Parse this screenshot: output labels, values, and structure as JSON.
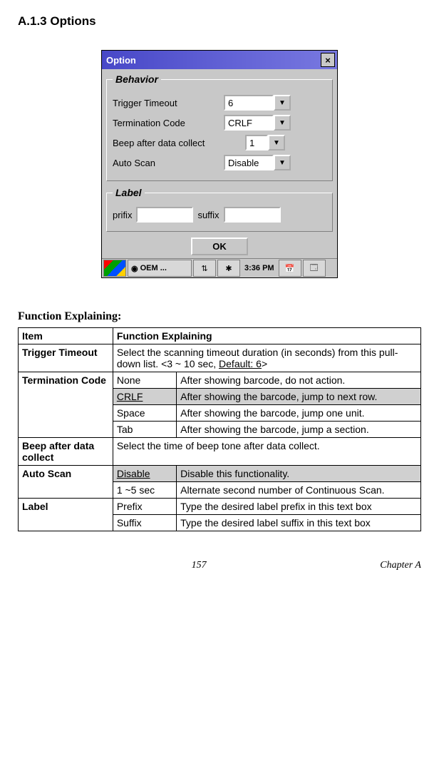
{
  "heading": "A.1.3    Options",
  "window": {
    "title": "Option",
    "behavior_legend": "Behavior",
    "label_legend": "Label",
    "trigger_timeout_label": "Trigger Timeout",
    "trigger_timeout_value": "6",
    "termination_code_label": "Termination Code",
    "termination_code_value": "CRLF",
    "beep_label": "Beep after data collect",
    "beep_value": "1",
    "auto_scan_label": "Auto Scan",
    "auto_scan_value": "Disable",
    "prefix_label": "prifix",
    "suffix_label": "suffix",
    "prefix_value": "",
    "suffix_value": "",
    "ok_label": "OK",
    "taskbar": {
      "oem": "OEM ...",
      "time": "3:36 PM"
    }
  },
  "func_heading": "Function Explaining:",
  "table": {
    "head_item": "Item",
    "head_func": "Function Explaining",
    "rows": {
      "trigger_timeout_item": "Trigger Timeout",
      "trigger_timeout_desc_a": "Select the scanning timeout duration (in seconds) from this pull-down list. <3 ~ 10 sec, ",
      "trigger_timeout_desc_b": "Default: 6",
      "trigger_timeout_desc_c": ">",
      "termination_code_item": "Termination Code",
      "termination_none": "None",
      "termination_none_desc": "After showing barcode, do not action.",
      "termination_crlf": "CRLF",
      "termination_crlf_desc": "After showing the barcode, jump to next row.",
      "termination_space": "Space",
      "termination_space_desc": "After showing the barcode, jump one unit.",
      "termination_tab": "Tab",
      "termination_tab_desc": "After showing the barcode, jump a section.",
      "beep_item": "Beep after data collect",
      "beep_desc": "Select the time of beep tone after data collect.",
      "autoscan_item": "Auto Scan",
      "autoscan_disable": "Disable",
      "autoscan_disable_desc": "Disable this functionality.",
      "autoscan_sec": "1 ~5 sec",
      "autoscan_sec_desc": "Alternate second number of Continuous Scan.",
      "label_item": "Label",
      "label_prefix": "Prefix",
      "label_prefix_desc": "Type the desired label prefix in this text box",
      "label_suffix": "Suffix",
      "label_suffix_desc": "Type the desired label suffix in this text box"
    }
  },
  "footer": {
    "page": "157",
    "chapter": "Chapter A"
  }
}
